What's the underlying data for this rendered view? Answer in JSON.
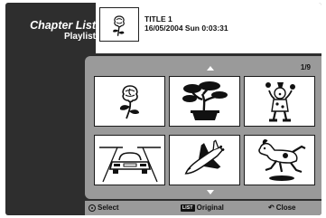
{
  "sidebar": {
    "title": "Chapter List",
    "subtitle": "Playlist"
  },
  "header": {
    "title": "TITLE 1",
    "info": "16/05/2004  Sun  0:03:31",
    "thumbnail_icon": "rose-icon"
  },
  "grid": {
    "page_indicator": "1/9",
    "items": [
      {
        "icon": "rose-icon"
      },
      {
        "icon": "bonsai-tree-icon"
      },
      {
        "icon": "clown-juggler-icon"
      },
      {
        "icon": "car-icon"
      },
      {
        "icon": "space-shuttle-icon"
      },
      {
        "icon": "running-dog-icon"
      }
    ]
  },
  "footer": {
    "select_label": "Select",
    "list_key": "LIST",
    "original_label": "Original",
    "close_label": "Close"
  }
}
